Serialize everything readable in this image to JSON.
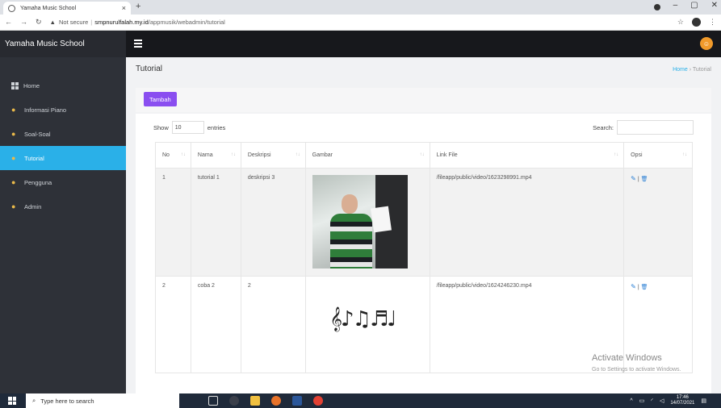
{
  "browser": {
    "tab_title": "Yamaha Music School",
    "tab_close": "×",
    "new_tab": "+",
    "not_secure": "Not secure",
    "url_host": "smpnurulfalah.my.id",
    "url_path": "/appmusik/webadmin/tutorial"
  },
  "app": {
    "brand": "Yamaha Music School",
    "sidebar": {
      "items": [
        {
          "label": "Home"
        },
        {
          "label": "Informasi Piano"
        },
        {
          "label": "Soal-Soal"
        },
        {
          "label": "Tutorial"
        },
        {
          "label": "Pengguna"
        },
        {
          "label": "Admin"
        }
      ]
    },
    "page_title": "Tutorial",
    "breadcrumb": {
      "home": "Home",
      "current": "Tutorial"
    },
    "add_button": "Tambah",
    "table_controls": {
      "show": "Show",
      "entries_value": "10",
      "entries": "entries",
      "search": "Search:"
    },
    "table": {
      "headers": [
        "No",
        "Nama",
        "Deskripsi",
        "Gambar",
        "Link File",
        "Opsi"
      ],
      "rows": [
        {
          "no": "1",
          "nama": "tutorial 1",
          "deskripsi": "deskripsi 3",
          "link": "/fileapp/public/video/1623298991.mp4"
        },
        {
          "no": "2",
          "nama": "coba 2",
          "deskripsi": "2",
          "link": "/fileapp/public/video/1624246230.mp4"
        }
      ]
    }
  },
  "watermark": {
    "title": "Activate Windows",
    "subtitle": "Go to Settings to activate Windows."
  },
  "taskbar": {
    "search_placeholder": "Type here to search",
    "time": "17:46",
    "date": "14/07/2021"
  }
}
